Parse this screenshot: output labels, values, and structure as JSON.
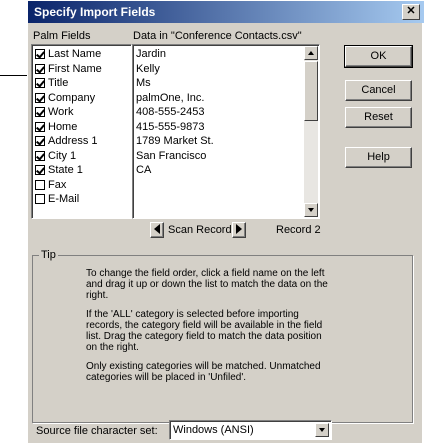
{
  "dialog": {
    "title": "Specify Import Fields"
  },
  "labels": {
    "palm_fields": "Palm Fields",
    "data_in": "Data in  \"Conference Contacts.csv\""
  },
  "fields": [
    {
      "label": "Last Name",
      "checked": true
    },
    {
      "label": "First Name",
      "checked": true
    },
    {
      "label": "Title",
      "checked": true
    },
    {
      "label": "Company",
      "checked": true
    },
    {
      "label": "Work",
      "checked": true
    },
    {
      "label": "Home",
      "checked": true
    },
    {
      "label": "Address 1",
      "checked": true
    },
    {
      "label": "City 1",
      "checked": true
    },
    {
      "label": "State 1",
      "checked": true
    },
    {
      "label": "Fax",
      "checked": false
    },
    {
      "label": "E-Mail",
      "checked": false
    }
  ],
  "data_values": [
    "Jardin",
    "Kelly",
    "Ms",
    "palmOne, Inc.",
    "408-555-2453",
    "415-555-9873",
    "1789 Market St.",
    "San Francisco",
    "CA",
    "",
    ""
  ],
  "buttons": {
    "ok": "OK",
    "cancel": "Cancel",
    "reset": "Reset",
    "help": "Help"
  },
  "scan": {
    "label": "Scan Records",
    "record": "Record 2"
  },
  "tip": {
    "title": "Tip",
    "p1": "To change the field order, click a field name on the left and drag it up or down the list to match the data on the right.",
    "p2": "If the 'ALL' category is selected before importing records,  the category field will be available in the field list.  Drag the category field to match the data position on the right.",
    "p3": "Only existing categories will be matched. Unmatched categories will be placed in 'Unfiled'."
  },
  "charset": {
    "label": "Source file character set:",
    "value": "Windows (ANSI)"
  }
}
